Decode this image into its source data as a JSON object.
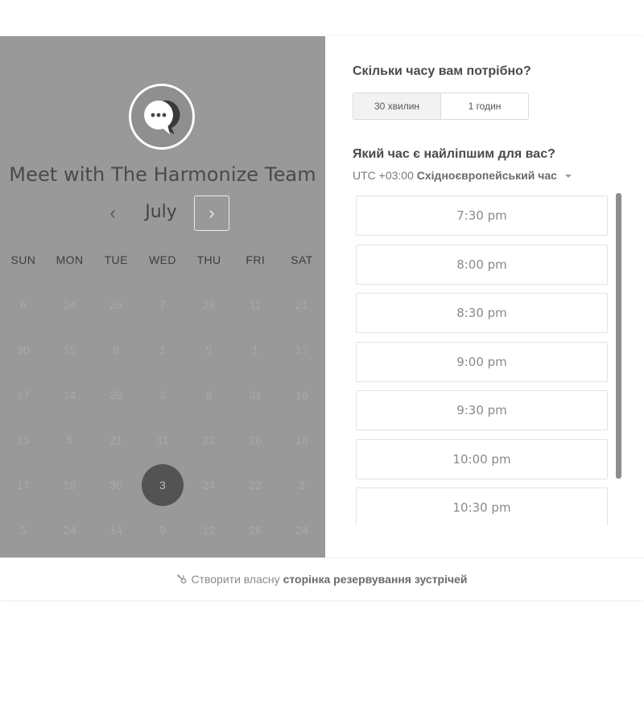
{
  "left_panel": {
    "avatar_icon": "chat-bubble-ellipsis-icon",
    "title": "Meet with The Harmonize Team",
    "month": "July",
    "prev_icon": "chevron-left-icon",
    "next_icon": "chevron-right-icon",
    "prev_glyph": "‹",
    "next_glyph": "›",
    "weekdays": [
      "SUN",
      "MON",
      "TUE",
      "WED",
      "THU",
      "FRI",
      "SAT"
    ],
    "weeks": [
      [
        "6",
        "24",
        "26",
        "7",
        "28",
        "11",
        "21"
      ],
      [
        "30",
        "15",
        "8",
        "1",
        "5",
        "1",
        "17"
      ],
      [
        "17",
        "14",
        "20",
        "3",
        "8",
        "31",
        "16"
      ],
      [
        "15",
        "5",
        "21",
        "31",
        "22",
        "26",
        "16"
      ],
      [
        "17",
        "18",
        "30",
        "3",
        "24",
        "22",
        "3"
      ],
      [
        "5",
        "24",
        "14",
        "9",
        "12",
        "26",
        "24"
      ]
    ],
    "selected_day": "3"
  },
  "right_panel": {
    "duration_question": "Скільки часу вам потрібно?",
    "durations": [
      "30 хвилин",
      "1 годин"
    ],
    "selected_duration": "30 хвилин",
    "time_question": "Який час є найліпшим для вас?",
    "tz_offset": "UTC +03:00",
    "tz_name": "Східноєвропейський час",
    "slots": [
      "7:30 pm",
      "8:00 pm",
      "8:30 pm",
      "9:00 pm",
      "9:30 pm",
      "10:00 pm",
      "10:30 pm"
    ]
  },
  "footer": {
    "icon": "hubspot-sprocket-icon",
    "prefix": "Створити власну",
    "link": "сторінка резервування зустрічей"
  },
  "colors": {
    "left_panel_bg": "#999999",
    "selected_day_bg": "#535353",
    "scrollbar": "#8e8e8e"
  }
}
